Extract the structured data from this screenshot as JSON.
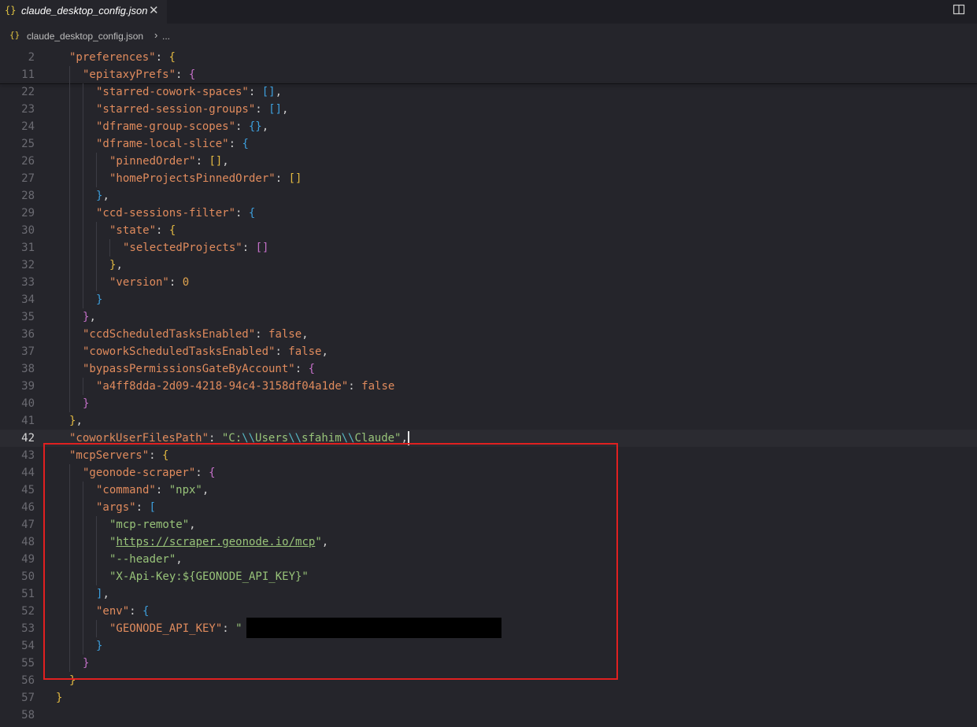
{
  "tab": {
    "icon": "json-braces-icon",
    "icon_glyph": "{}",
    "title": "claude_desktop_config.json",
    "close_glyph": "✕"
  },
  "toolbar": {
    "split_editor_icon": "split-editor-icon"
  },
  "breadcrumb": {
    "icon_glyph": "{}",
    "file": "claude_desktop_config.json",
    "separator": "›",
    "more": "..."
  },
  "editor": {
    "current_line": 42,
    "lines": [
      {
        "n": "2",
        "indent": 1,
        "tokens": [
          [
            "k",
            "\"preferences\""
          ],
          [
            "p",
            ": "
          ],
          [
            "b1",
            "{"
          ]
        ]
      },
      {
        "n": "11",
        "indent": 2,
        "tokens": [
          [
            "k",
            "\"epitaxyPrefs\""
          ],
          [
            "p",
            ": "
          ],
          [
            "b2",
            "{"
          ]
        ]
      },
      {
        "n": "22",
        "indent": 3,
        "tokens": [
          [
            "k",
            "\"starred-cowork-spaces\""
          ],
          [
            "p",
            ": "
          ],
          [
            "b3",
            "[]"
          ],
          [
            "p",
            ","
          ]
        ]
      },
      {
        "n": "23",
        "indent": 3,
        "tokens": [
          [
            "k",
            "\"starred-session-groups\""
          ],
          [
            "p",
            ": "
          ],
          [
            "b3",
            "[]"
          ],
          [
            "p",
            ","
          ]
        ]
      },
      {
        "n": "24",
        "indent": 3,
        "tokens": [
          [
            "k",
            "\"dframe-group-scopes\""
          ],
          [
            "p",
            ": "
          ],
          [
            "b3",
            "{}"
          ],
          [
            "p",
            ","
          ]
        ]
      },
      {
        "n": "25",
        "indent": 3,
        "tokens": [
          [
            "k",
            "\"dframe-local-slice\""
          ],
          [
            "p",
            ": "
          ],
          [
            "b3",
            "{"
          ]
        ]
      },
      {
        "n": "26",
        "indent": 4,
        "tokens": [
          [
            "k",
            "\"pinnedOrder\""
          ],
          [
            "p",
            ": "
          ],
          [
            "b1",
            "[]"
          ],
          [
            "p",
            ","
          ]
        ]
      },
      {
        "n": "27",
        "indent": 4,
        "tokens": [
          [
            "k",
            "\"homeProjectsPinnedOrder\""
          ],
          [
            "p",
            ": "
          ],
          [
            "b1",
            "[]"
          ]
        ]
      },
      {
        "n": "28",
        "indent": 3,
        "tokens": [
          [
            "b3",
            "}"
          ],
          [
            "p",
            ","
          ]
        ]
      },
      {
        "n": "29",
        "indent": 3,
        "tokens": [
          [
            "k",
            "\"ccd-sessions-filter\""
          ],
          [
            "p",
            ": "
          ],
          [
            "b3",
            "{"
          ]
        ]
      },
      {
        "n": "30",
        "indent": 4,
        "tokens": [
          [
            "k",
            "\"state\""
          ],
          [
            "p",
            ": "
          ],
          [
            "b1",
            "{"
          ]
        ]
      },
      {
        "n": "31",
        "indent": 5,
        "tokens": [
          [
            "k",
            "\"selectedProjects\""
          ],
          [
            "p",
            ": "
          ],
          [
            "b2",
            "[]"
          ]
        ]
      },
      {
        "n": "32",
        "indent": 4,
        "tokens": [
          [
            "b1",
            "}"
          ],
          [
            "p",
            ","
          ]
        ]
      },
      {
        "n": "33",
        "indent": 4,
        "tokens": [
          [
            "k",
            "\"version\""
          ],
          [
            "p",
            ": "
          ],
          [
            "num",
            "0"
          ]
        ]
      },
      {
        "n": "34",
        "indent": 3,
        "tokens": [
          [
            "b3",
            "}"
          ]
        ]
      },
      {
        "n": "35",
        "indent": 2,
        "tokens": [
          [
            "b2",
            "}"
          ],
          [
            "p",
            ","
          ]
        ]
      },
      {
        "n": "36",
        "indent": 2,
        "tokens": [
          [
            "k",
            "\"ccdScheduledTasksEnabled\""
          ],
          [
            "p",
            ": "
          ],
          [
            "kw",
            "false"
          ],
          [
            "p",
            ","
          ]
        ]
      },
      {
        "n": "37",
        "indent": 2,
        "tokens": [
          [
            "k",
            "\"coworkScheduledTasksEnabled\""
          ],
          [
            "p",
            ": "
          ],
          [
            "kw",
            "false"
          ],
          [
            "p",
            ","
          ]
        ]
      },
      {
        "n": "38",
        "indent": 2,
        "tokens": [
          [
            "k",
            "\"bypassPermissionsGateByAccount\""
          ],
          [
            "p",
            ": "
          ],
          [
            "b2",
            "{"
          ]
        ]
      },
      {
        "n": "39",
        "indent": 3,
        "tokens": [
          [
            "k",
            "\"a4ff8dda-2d09-4218-94c4-3158df04a1de\""
          ],
          [
            "p",
            ": "
          ],
          [
            "kw",
            "false"
          ]
        ]
      },
      {
        "n": "40",
        "indent": 2,
        "tokens": [
          [
            "b2",
            "}"
          ]
        ]
      },
      {
        "n": "41",
        "indent": 1,
        "tokens": [
          [
            "b1",
            "}"
          ],
          [
            "p",
            ","
          ]
        ]
      },
      {
        "n": "42",
        "indent": 1,
        "tokens": [
          [
            "k",
            "\"coworkUserFilesPath\""
          ],
          [
            "p",
            ": "
          ],
          [
            "s",
            "\"C:"
          ],
          [
            "esc",
            "\\\\"
          ],
          [
            "s",
            "Users"
          ],
          [
            "esc",
            "\\\\"
          ],
          [
            "s",
            "sfahim"
          ],
          [
            "esc",
            "\\\\"
          ],
          [
            "s",
            "Claude\""
          ],
          [
            "p",
            ","
          ],
          [
            "cursor",
            ""
          ]
        ]
      },
      {
        "n": "43",
        "indent": 1,
        "tokens": [
          [
            "k",
            "\"mcpServers\""
          ],
          [
            "p",
            ": "
          ],
          [
            "b1",
            "{"
          ]
        ]
      },
      {
        "n": "44",
        "indent": 2,
        "tokens": [
          [
            "k",
            "\"geonode-scraper\""
          ],
          [
            "p",
            ": "
          ],
          [
            "b2",
            "{"
          ]
        ]
      },
      {
        "n": "45",
        "indent": 3,
        "tokens": [
          [
            "k",
            "\"command\""
          ],
          [
            "p",
            ": "
          ],
          [
            "s",
            "\"npx\""
          ],
          [
            "p",
            ","
          ]
        ]
      },
      {
        "n": "46",
        "indent": 3,
        "tokens": [
          [
            "k",
            "\"args\""
          ],
          [
            "p",
            ": "
          ],
          [
            "b3",
            "["
          ]
        ]
      },
      {
        "n": "47",
        "indent": 4,
        "tokens": [
          [
            "s",
            "\"mcp-remote\""
          ],
          [
            "p",
            ","
          ]
        ]
      },
      {
        "n": "48",
        "indent": 4,
        "tokens": [
          [
            "s",
            "\""
          ],
          [
            "url",
            "https://scraper.geonode.io/mcp"
          ],
          [
            "s",
            "\""
          ],
          [
            "p",
            ","
          ]
        ]
      },
      {
        "n": "49",
        "indent": 4,
        "tokens": [
          [
            "s",
            "\"--header\""
          ],
          [
            "p",
            ","
          ]
        ]
      },
      {
        "n": "50",
        "indent": 4,
        "tokens": [
          [
            "s",
            "\"X-Api-Key:${GEONODE_API_KEY}\""
          ]
        ]
      },
      {
        "n": "51",
        "indent": 3,
        "tokens": [
          [
            "b3",
            "]"
          ],
          [
            "p",
            ","
          ]
        ]
      },
      {
        "n": "52",
        "indent": 3,
        "tokens": [
          [
            "k",
            "\"env\""
          ],
          [
            "p",
            ": "
          ],
          [
            "b3",
            "{"
          ]
        ]
      },
      {
        "n": "53",
        "indent": 4,
        "tokens": [
          [
            "k",
            "\"GEONODE_API_KEY\""
          ],
          [
            "p",
            ": "
          ],
          [
            "s",
            "\""
          ],
          [
            "gap",
            "                                      "
          ],
          [
            "s",
            "\""
          ]
        ]
      },
      {
        "n": "54",
        "indent": 3,
        "tokens": [
          [
            "b3",
            "}"
          ]
        ]
      },
      {
        "n": "55",
        "indent": 2,
        "tokens": [
          [
            "b2",
            "}"
          ]
        ]
      },
      {
        "n": "56",
        "indent": 1,
        "tokens": [
          [
            "b1",
            "}"
          ]
        ]
      },
      {
        "n": "57",
        "indent": 0,
        "tokens": [
          [
            "b1",
            "}"
          ]
        ]
      },
      {
        "n": "58",
        "indent": 0,
        "tokens": []
      }
    ]
  },
  "annotations": {
    "highlight_color": "#e02020",
    "redaction_color": "#000000"
  }
}
